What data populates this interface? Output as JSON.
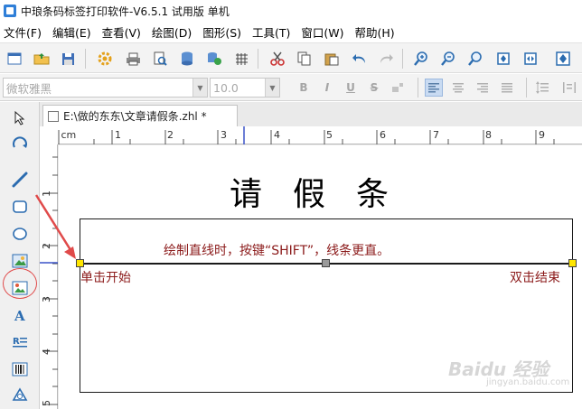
{
  "window": {
    "title": "中琅条码标签打印软件-V6.5.1 试用版 单机"
  },
  "menu": [
    {
      "label": "文件(F)",
      "name": "menu-file"
    },
    {
      "label": "编辑(E)",
      "name": "menu-edit"
    },
    {
      "label": "查看(V)",
      "name": "menu-view"
    },
    {
      "label": "绘图(D)",
      "name": "menu-draw"
    },
    {
      "label": "图形(S)",
      "name": "menu-shape"
    },
    {
      "label": "工具(T)",
      "name": "menu-tools"
    },
    {
      "label": "窗口(W)",
      "name": "menu-window"
    },
    {
      "label": "帮助(H)",
      "name": "menu-help"
    }
  ],
  "format_bar": {
    "font_value": "微软雅黑",
    "size_value": "10.0",
    "bold": "B",
    "italic": "I",
    "underline": "U",
    "strike": "S"
  },
  "document": {
    "tab_label": "E:\\做的东东\\文章请假条.zhl *",
    "title": "请假条",
    "hint": "绘制直线时，按键“SHIFT”，线条更直。",
    "start_label": "单击开始",
    "end_label": "双击结束"
  },
  "ruler": {
    "top_numbers": [
      "0 cm",
      "1",
      "2",
      "3",
      "4",
      "5",
      "6",
      "7",
      "8",
      "9"
    ],
    "left_numbers": [
      "1",
      "2",
      "3",
      "4",
      "5"
    ]
  },
  "watermark": {
    "main": "Baidu 经验",
    "sub": "jingyan.baidu.com"
  },
  "colors": {
    "accent_red": "#8b1a1a",
    "handle_yellow": "#ffe600",
    "handle_gray": "#9a9a9a",
    "circle_red": "#e04a4a"
  }
}
